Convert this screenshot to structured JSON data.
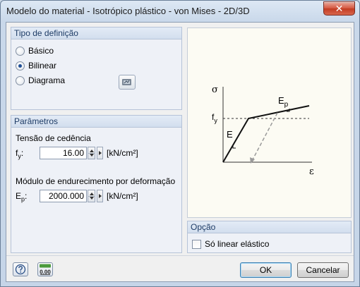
{
  "window": {
    "title": "Modelo do material - Isotrópico plástico - von Mises - 2D/3D",
    "close_glyph": "✕"
  },
  "definition_type": {
    "header": "Tipo de definição",
    "options": [
      {
        "label": "Básico",
        "checked": false
      },
      {
        "label": "Bilinear",
        "checked": true
      },
      {
        "label": "Diagrama",
        "checked": false
      }
    ],
    "diagram_button_icon": "diagram-edit-icon"
  },
  "parameters": {
    "header": "Parâmetros",
    "yield_stress": {
      "label": "Tensão de cedência",
      "symbol": "f",
      "symbol_sub": "y",
      "symbol_colon": ":",
      "value": "16.00",
      "unit": "[kN/cm²]"
    },
    "hardening_modulus": {
      "label": "Módulo de endurecimento por deformação",
      "symbol": "E",
      "symbol_sub": "p",
      "symbol_colon": ":",
      "value": "2000.000",
      "unit": "[kN/cm²]"
    }
  },
  "preview": {
    "sigma": "σ",
    "epsilon": "ε",
    "fy": "f",
    "fy_sub": "y",
    "E": "E",
    "Ep": "E",
    "Ep_sub": "p"
  },
  "option": {
    "header": "Opção",
    "linear_elastic_label": "Só linear elástico",
    "linear_elastic_checked": false
  },
  "footer": {
    "help_icon": "help-icon",
    "units_icon": "units-decimal-icon",
    "units_text": "0.00",
    "ok_label": "OK",
    "cancel_label": "Cancelar"
  }
}
